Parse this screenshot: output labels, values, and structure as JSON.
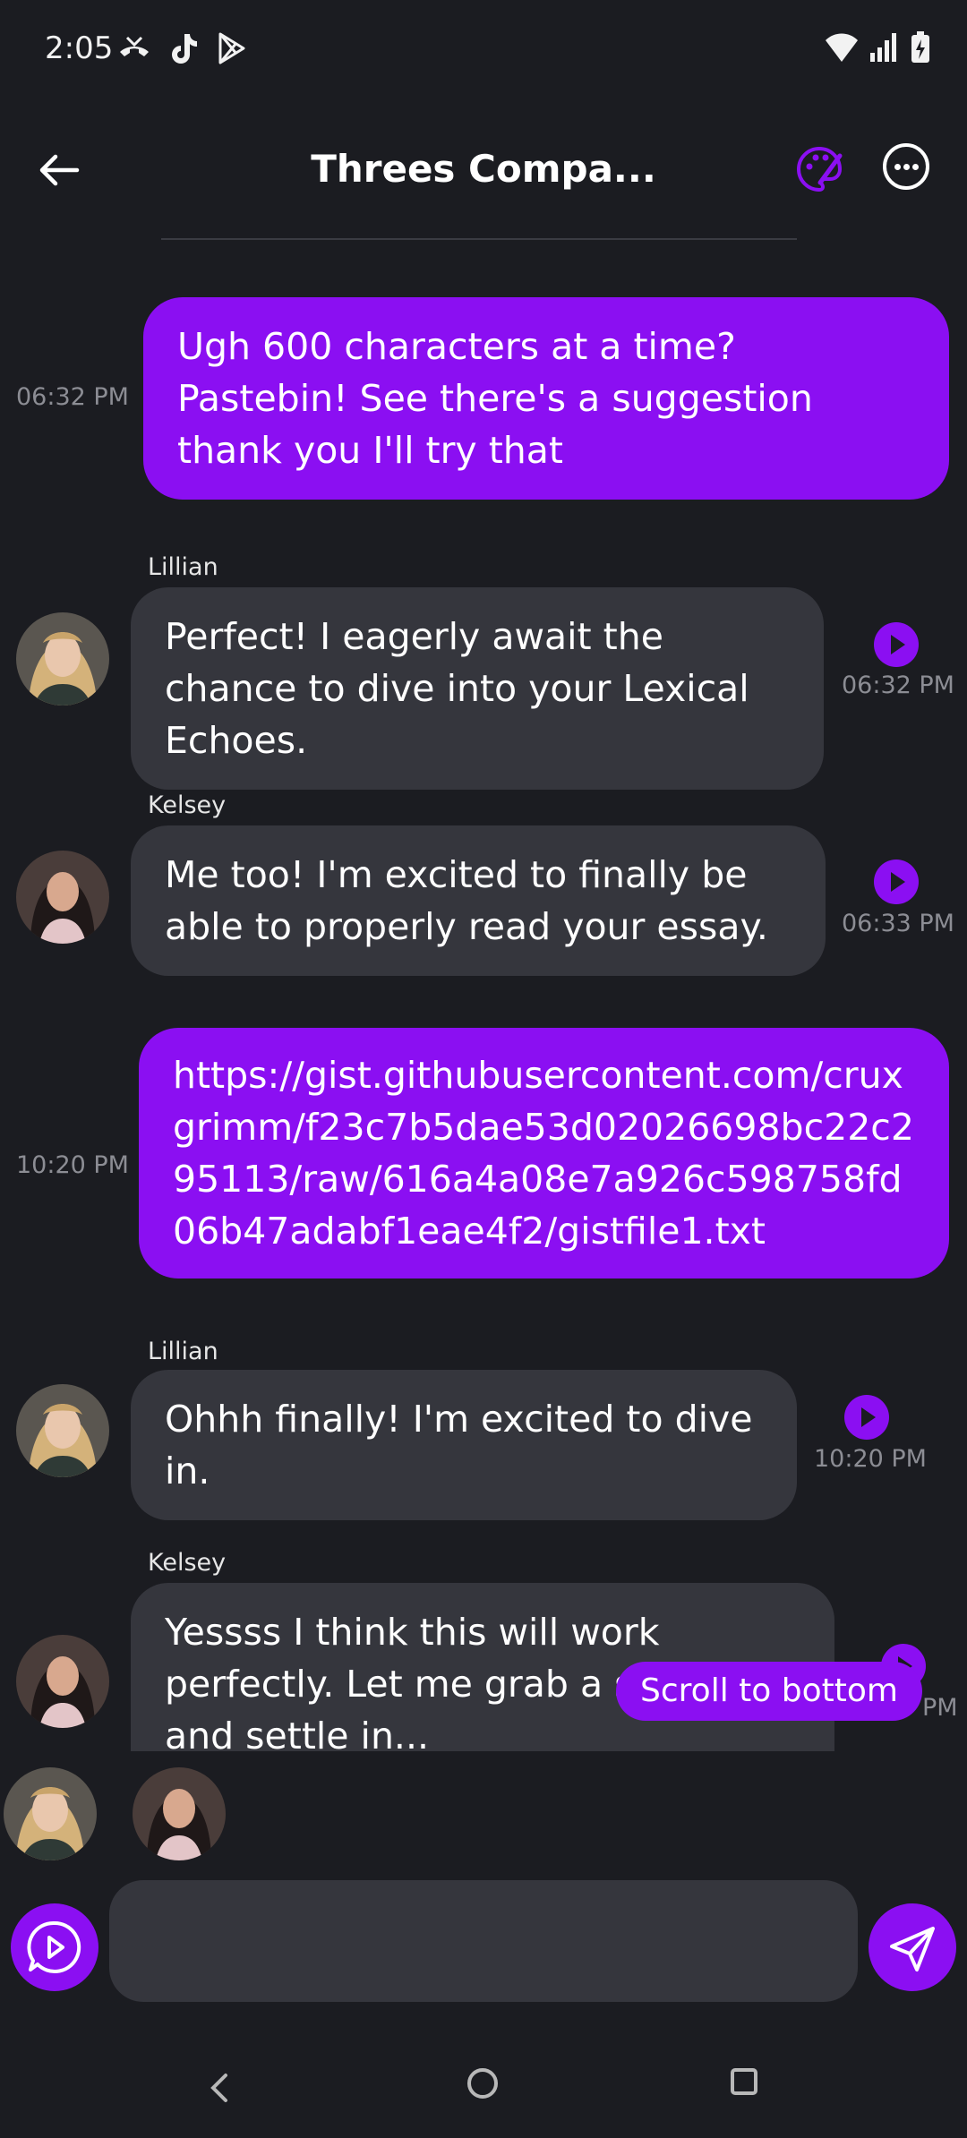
{
  "status_bar": {
    "time": "2:05",
    "left_icons": [
      "missed-call-icon",
      "tiktok-icon",
      "play-store-icon"
    ],
    "right_icons": [
      "wifi-icon",
      "signal-icon",
      "battery-charging-icon"
    ]
  },
  "header": {
    "title": "Threes Compa...",
    "accent_color": "#8b0ff2"
  },
  "messages": [
    {
      "type": "outgoing",
      "text": "Ugh 600 characters at a time? Pastebin! See there's a suggestion thank you I'll try that",
      "time": "06:32 PM"
    },
    {
      "type": "incoming",
      "sender": "Lillian",
      "text": "Perfect! I eagerly await the chance to dive into your Lexical Echoes.",
      "time": "06:32 PM"
    },
    {
      "type": "incoming",
      "sender": "Kelsey",
      "text": "Me too! I'm excited to finally be able to properly read your essay.",
      "time": "06:33 PM"
    },
    {
      "type": "outgoing",
      "text": "https://gist.githubusercontent.com/cruxgrimm/f23c7b5dae53d02026698bc22c295113/raw/616a4a08e7a926c598758fd06b47adabf1eae4f2/gistfile1.txt",
      "time": "10:20 PM"
    },
    {
      "type": "incoming",
      "sender": "Lillian",
      "text": "Ohhh finally! I'm excited to dive in.",
      "time": "10:20 PM"
    },
    {
      "type": "incoming",
      "sender": "Kelsey",
      "text": "Yessss I think this will work perfectly. Let me grab a snack and settle in...",
      "time": "PM"
    }
  ],
  "scroll_to_bottom": "Scroll to bottom",
  "input": {
    "value": "",
    "placeholder": ""
  }
}
